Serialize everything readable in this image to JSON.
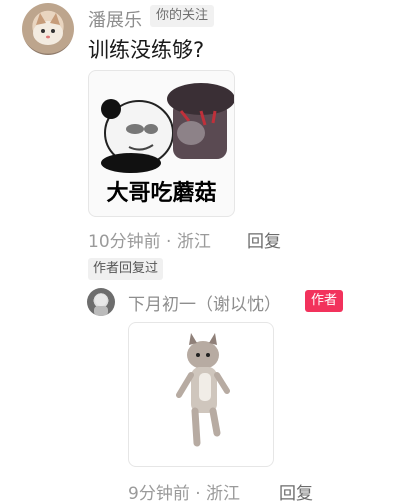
{
  "comment": {
    "username": "潘展乐",
    "follow_tag": "你的关注",
    "text": "训练没练够?",
    "sticker": {
      "caption": "大哥吃蘑菇"
    },
    "time": "10分钟前",
    "location": "浙江",
    "reply_label": "回复",
    "author_replied_tag": "作者回复过"
  },
  "reply": {
    "username": "下月初一（谢以忱）",
    "author_badge": "作者",
    "time": "9分钟前",
    "location": "浙江",
    "reply_label": "回复"
  },
  "colors": {
    "author_badge": "#f2325c",
    "muted_text": "#9a9a9a"
  }
}
